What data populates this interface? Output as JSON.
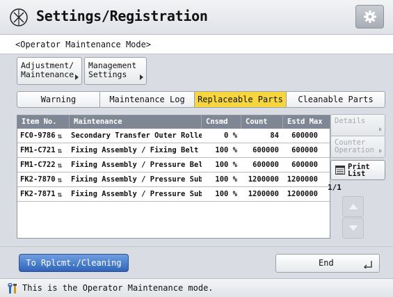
{
  "window": {
    "title": "Settings/Registration"
  },
  "mode": {
    "label": "<Operator Maintenance Mode>"
  },
  "subnav": {
    "adjustment_line1": "Adjustment/",
    "adjustment_line2": "Maintenance",
    "management_line1": "Management",
    "management_line2": "Settings"
  },
  "tabs": [
    {
      "label": "Warning"
    },
    {
      "label": "Maintenance Log"
    },
    {
      "label": "Replaceable Parts",
      "active": true
    },
    {
      "label": "Cleanable Parts"
    }
  ],
  "table": {
    "headers": [
      "Item No.",
      "Maintenance",
      "Cnsmd",
      "Count",
      "Estd Max"
    ],
    "rows": [
      {
        "item": "FC0-9786",
        "maintenance": "Secondary Transfer Outer Roller",
        "cnsmd": "0 %",
        "count": "84",
        "max": "600000"
      },
      {
        "item": "FM1-C721",
        "maintenance": "Fixing Assembly / Fixing Belt Uni",
        "cnsmd": "100 %",
        "count": "600000",
        "max": "600000"
      },
      {
        "item": "FM1-C722",
        "maintenance": "Fixing Assembly / Pressure Belt U",
        "cnsmd": "100 %",
        "count": "600000",
        "max": "600000"
      },
      {
        "item": "FK2-7870",
        "maintenance": "Fixing Assembly / Pressure Sub Th",
        "cnsmd": "100 %",
        "count": "1200000",
        "max": "1200000"
      },
      {
        "item": "FK2-7871",
        "maintenance": "Fixing Assembly / Pressure Sub Th",
        "cnsmd": "100 %",
        "count": "1200000",
        "max": "1200000"
      }
    ]
  },
  "side": {
    "details": "Details",
    "counter_line1": "Counter",
    "counter_line2": "Operation",
    "print_line1": "Print",
    "print_line2": "List",
    "page": "1/1"
  },
  "bottom": {
    "to_replacement": "To Rplcmt./Cleaning",
    "end": "End"
  },
  "status": {
    "message": "This is the Operator Maintenance mode."
  },
  "colors": {
    "active_tab": "#f6d63c",
    "primary_button": "#3b70c4",
    "table_header": "#7e8793"
  }
}
